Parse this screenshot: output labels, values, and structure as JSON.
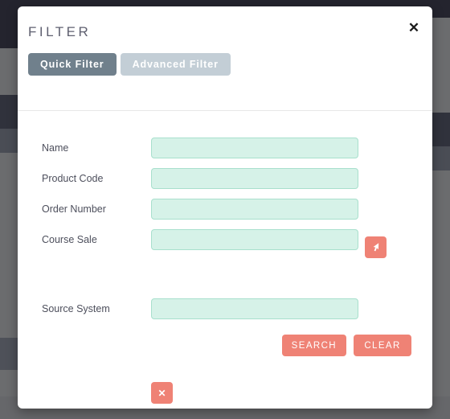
{
  "modal": {
    "title": "FILTER",
    "close_label": "✕",
    "tabs": [
      {
        "label": "Quick Filter",
        "active": true
      },
      {
        "label": "Advanced Filter",
        "active": false
      }
    ],
    "fields": [
      {
        "label": "Name",
        "value": "",
        "placeholder": ""
      },
      {
        "label": "Product Code",
        "value": "",
        "placeholder": ""
      },
      {
        "label": "Order Number",
        "value": "",
        "placeholder": ""
      },
      {
        "label": "Course Sale",
        "value": "",
        "placeholder": ""
      },
      {
        "label": "Source System",
        "value": "",
        "placeholder": ""
      }
    ],
    "picker_button": {
      "icon": "cursor-arrow-icon"
    },
    "remove_button": {
      "label": "✕",
      "icon": "close-icon"
    },
    "actions": [
      {
        "label": "SEARCH"
      },
      {
        "label": "CLEAR"
      }
    ]
  },
  "colors": {
    "accent_coral": "#ef8275",
    "tab_active": "#70808c",
    "tab_inactive": "#c3ced6",
    "input_bg": "#d6f2e8",
    "input_border": "#a8e0cd",
    "label_text": "#4d4f5c",
    "title_text": "#5f6070",
    "overlay": "#5a5b5f",
    "topbar": "#24242e"
  }
}
